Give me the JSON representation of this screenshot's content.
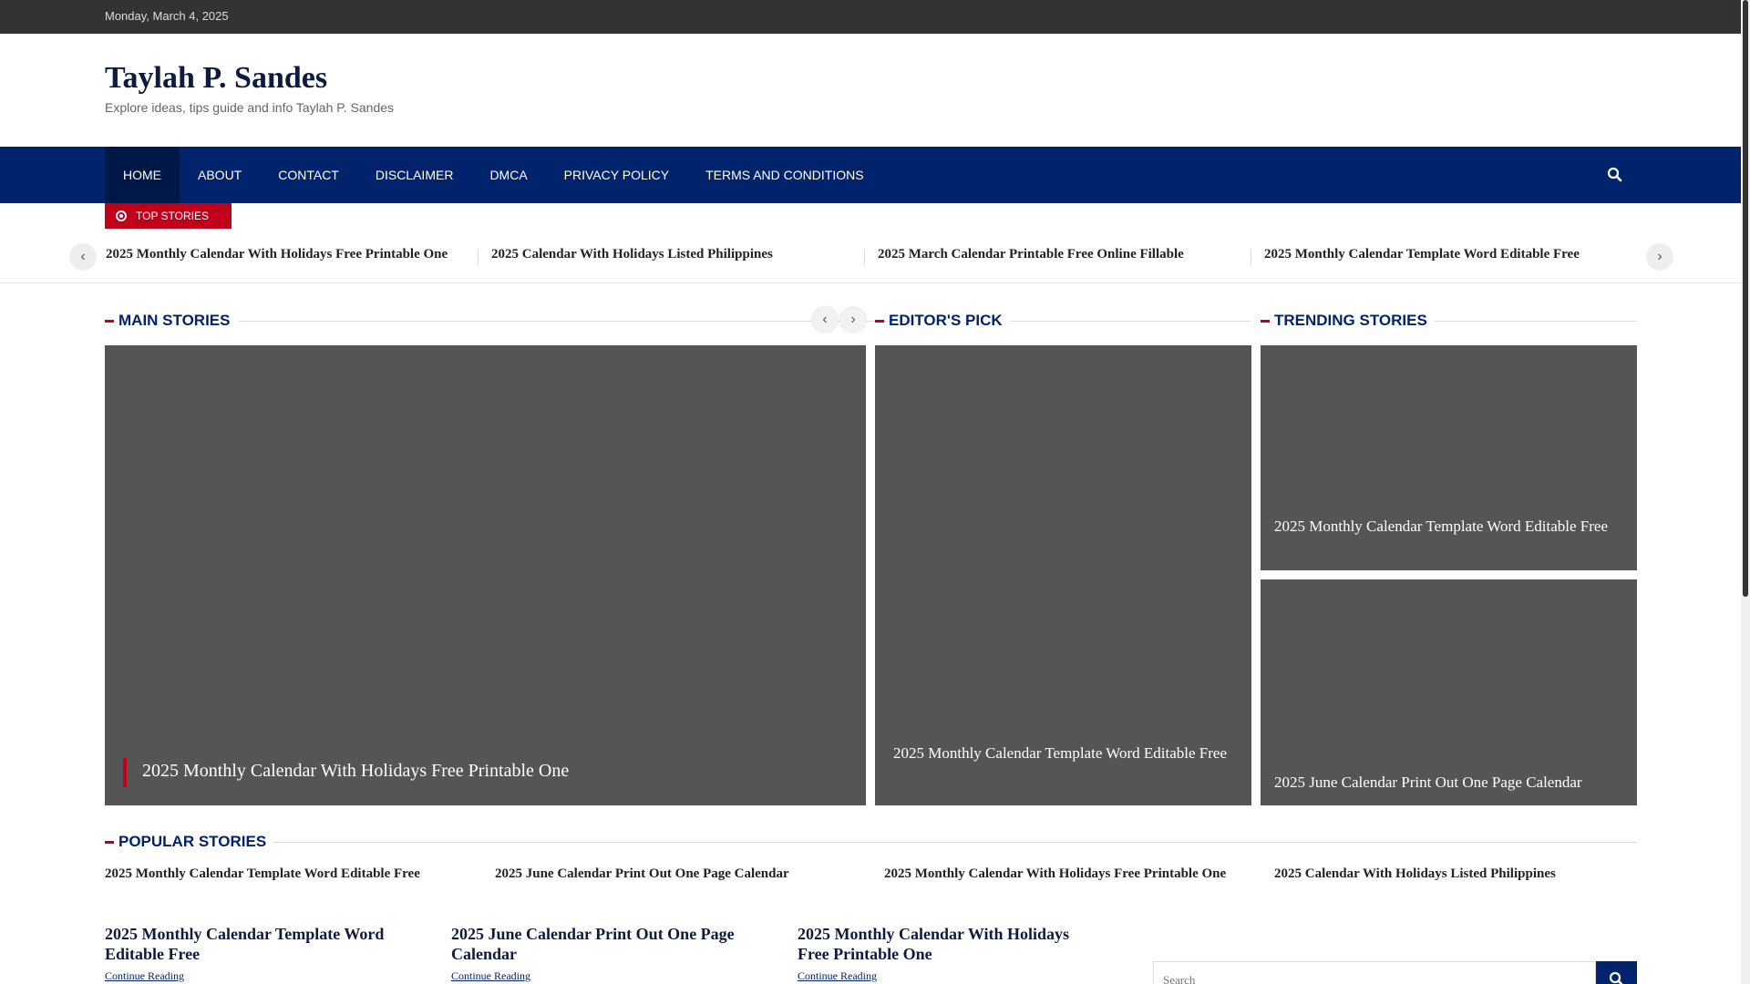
{
  "topbar": {
    "date": "Monday, March 4, 2025"
  },
  "site": {
    "title": "Taylah P. Sandes",
    "description": "Explore ideas, tips guide and info Taylah P. Sandes"
  },
  "nav": {
    "items": [
      "HOME",
      "ABOUT",
      "CONTACT",
      "DISCLAIMER",
      "DMCA",
      "PRIVACY POLICY",
      "TERMS AND CONDITIONS"
    ],
    "active": "HOME",
    "search_icon": "search-icon"
  },
  "ticker": {
    "label": "TOP STORIES",
    "items": [
      "2025 Monthly Calendar With Holidays Free Printable One",
      "2025 Calendar With Holidays Listed Philippines",
      "2025 March Calendar Printable Free Online Fillable",
      "2025 Monthly Calendar Template Word Editable Free"
    ],
    "prev_icon": "chevron-left-icon",
    "next_icon": "chevron-right-icon"
  },
  "sections": {
    "main": "MAIN STORIES",
    "editors": "EDITOR'S PICK",
    "trending": "TRENDING STORIES",
    "popular": "POPULAR STORIES"
  },
  "main_story": {
    "title": "2025 Monthly Calendar With Holidays Free Printable One"
  },
  "editors_pick": {
    "title": "2025 Monthly Calendar Template Word Editable Free"
  },
  "trending": [
    {
      "title": "2025 Monthly Calendar Template Word Editable Free"
    },
    {
      "title": "2025 June Calendar Print Out One Page Calendar"
    }
  ],
  "popular": [
    "2025 Monthly Calendar Template Word Editable Free",
    "2025 June Calendar Print Out One Page Calendar",
    "2025 Monthly Calendar With Holidays Free Printable One",
    "2025 Calendar With Holidays Listed Philippines"
  ],
  "posts": [
    {
      "title": "2025 Monthly Calendar Template Word Editable Free",
      "more": "Continue Reading"
    },
    {
      "title": "2025 June Calendar Print Out One Page Calendar",
      "more": "Continue Reading"
    },
    {
      "title": "2025 Monthly Calendar With Holidays Free Printable One",
      "more": "Continue Reading"
    }
  ],
  "search": {
    "placeholder": "Search"
  },
  "colors": {
    "nav_bg": "#00236b",
    "accent": "#c0001a",
    "card_bg": "#555555",
    "topbar_bg": "#333333"
  }
}
